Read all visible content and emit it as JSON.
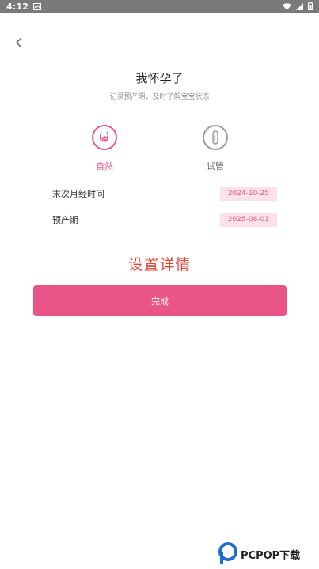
{
  "status_bar": {
    "time": "4:12"
  },
  "header": {
    "title": "我怀孕了",
    "subtitle": "记录预产期，及时了解宝宝状态"
  },
  "options": [
    {
      "label": "自然",
      "selected": true,
      "icon": "natural-pregnancy-icon"
    },
    {
      "label": "试管",
      "selected": false,
      "icon": "test-tube-icon"
    }
  ],
  "fields": [
    {
      "label": "末次月经时间",
      "value": "2024-10-25"
    },
    {
      "label": "预产期",
      "value": "2025-08-01"
    }
  ],
  "section_heading": "设置详情",
  "done_button": "完成",
  "watermark": "PCPOP下载",
  "colors": {
    "accent": "#e95586",
    "heading_red": "#e0463a",
    "value_bg": "#fbe1e8"
  }
}
